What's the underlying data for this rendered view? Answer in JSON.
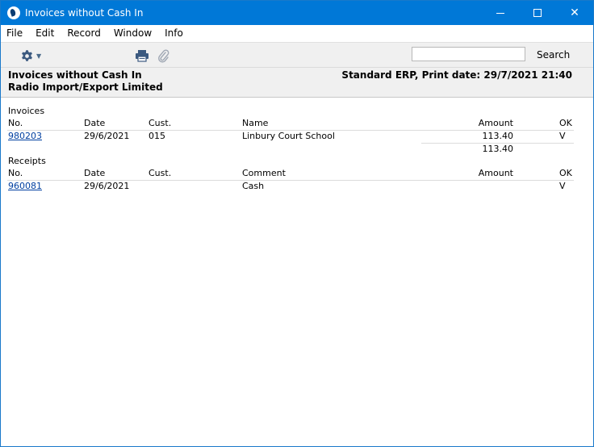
{
  "window": {
    "title": "Invoices without Cash In",
    "min_label": "",
    "max_label": "",
    "close_label": "✕"
  },
  "menu": [
    "File",
    "Edit",
    "Record",
    "Window",
    "Info"
  ],
  "toolbar": {
    "search_value": "",
    "search_button": "Search",
    "gear_icon": "gear-icon",
    "print_icon": "print-icon",
    "attach_icon": "paperclip-icon"
  },
  "report": {
    "title": "Invoices without Cash In",
    "company": "Radio Import/Export Limited",
    "print_info": "Standard ERP, Print date: 29/7/2021 21:40"
  },
  "invoices": {
    "section_label": "Invoices",
    "headers": {
      "no": "No.",
      "date": "Date",
      "cust": "Cust.",
      "name": "Name",
      "amount": "Amount",
      "ok": "OK"
    },
    "rows": [
      {
        "no": "980203",
        "date": "29/6/2021",
        "cust": "015",
        "name": "Linbury Court School",
        "amount": "113.40",
        "ok": "V"
      }
    ],
    "total": "113.40"
  },
  "receipts": {
    "section_label": "Receipts",
    "headers": {
      "no": "No.",
      "date": "Date",
      "cust": "Cust.",
      "comment": "Comment",
      "amount": "Amount",
      "ok": "OK"
    },
    "rows": [
      {
        "no": "960081",
        "date": "29/6/2021",
        "cust": "",
        "comment": "Cash",
        "amount": "",
        "ok": "V"
      }
    ]
  }
}
